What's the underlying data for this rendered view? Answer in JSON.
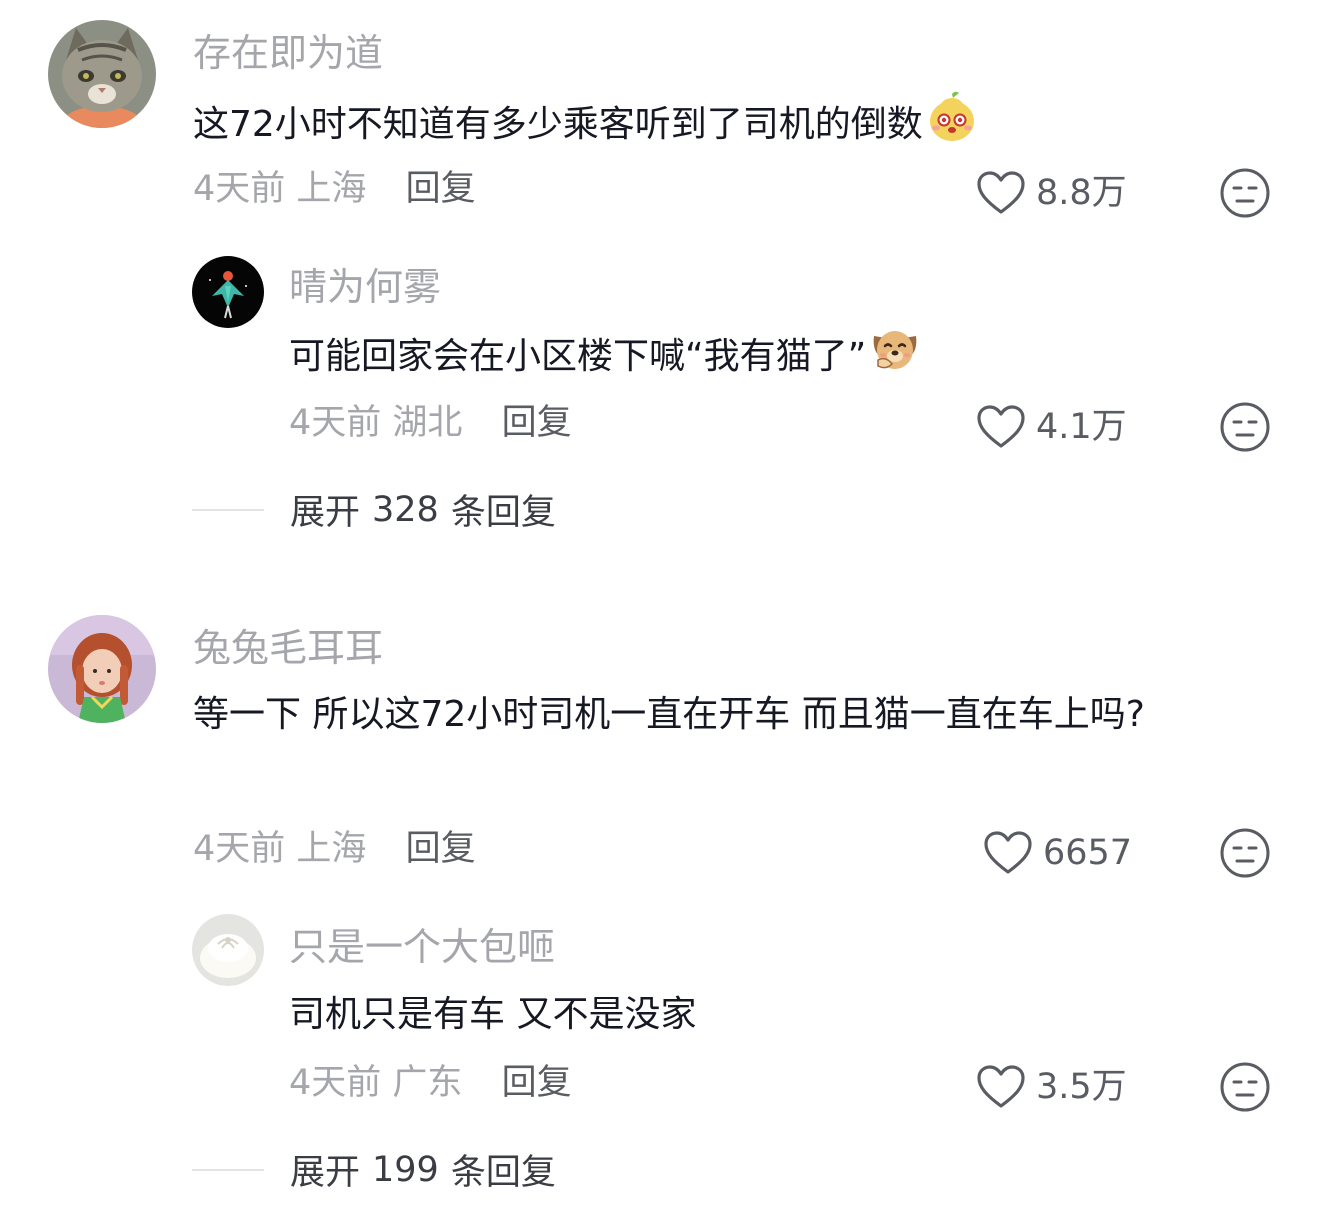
{
  "comments": [
    {
      "username": "存在即为道",
      "text": "这72小时不知道有多少乘客听到了司机的倒数",
      "time": "4天前",
      "location": "上海",
      "reply_label": "回复",
      "likes": "8.8万",
      "replies": [
        {
          "username": "晴为何雾",
          "text": "可能回家会在小区楼下喊“我有猫了”",
          "time": "4天前",
          "location": "湖北",
          "reply_label": "回复",
          "likes": "4.1万"
        }
      ],
      "expand": {
        "label": "展开",
        "count": "328",
        "suffix": "条回复"
      }
    },
    {
      "username": "兔兔毛耳耳",
      "text": "等一下 所以这72小时司机一直在开车 而且猫一直在车上吗?",
      "time": "4天前",
      "location": "上海",
      "reply_label": "回复",
      "likes": "6657",
      "replies": [
        {
          "username": "只是一个大包咂",
          "text": "司机只是有车 又不是没家",
          "time": "4天前",
          "location": "广东",
          "reply_label": "回复",
          "likes": "3.5万"
        }
      ],
      "expand": {
        "label": "展开",
        "count": "199",
        "suffix": "条回复"
      }
    }
  ],
  "icons": {
    "like": "heart-outline-icon",
    "dislike": "unamused-face-icon"
  },
  "colors": {
    "username": "#a4a6ab",
    "text": "#161823",
    "meta": "#a4a6ab",
    "reply": "#5a5c63"
  }
}
